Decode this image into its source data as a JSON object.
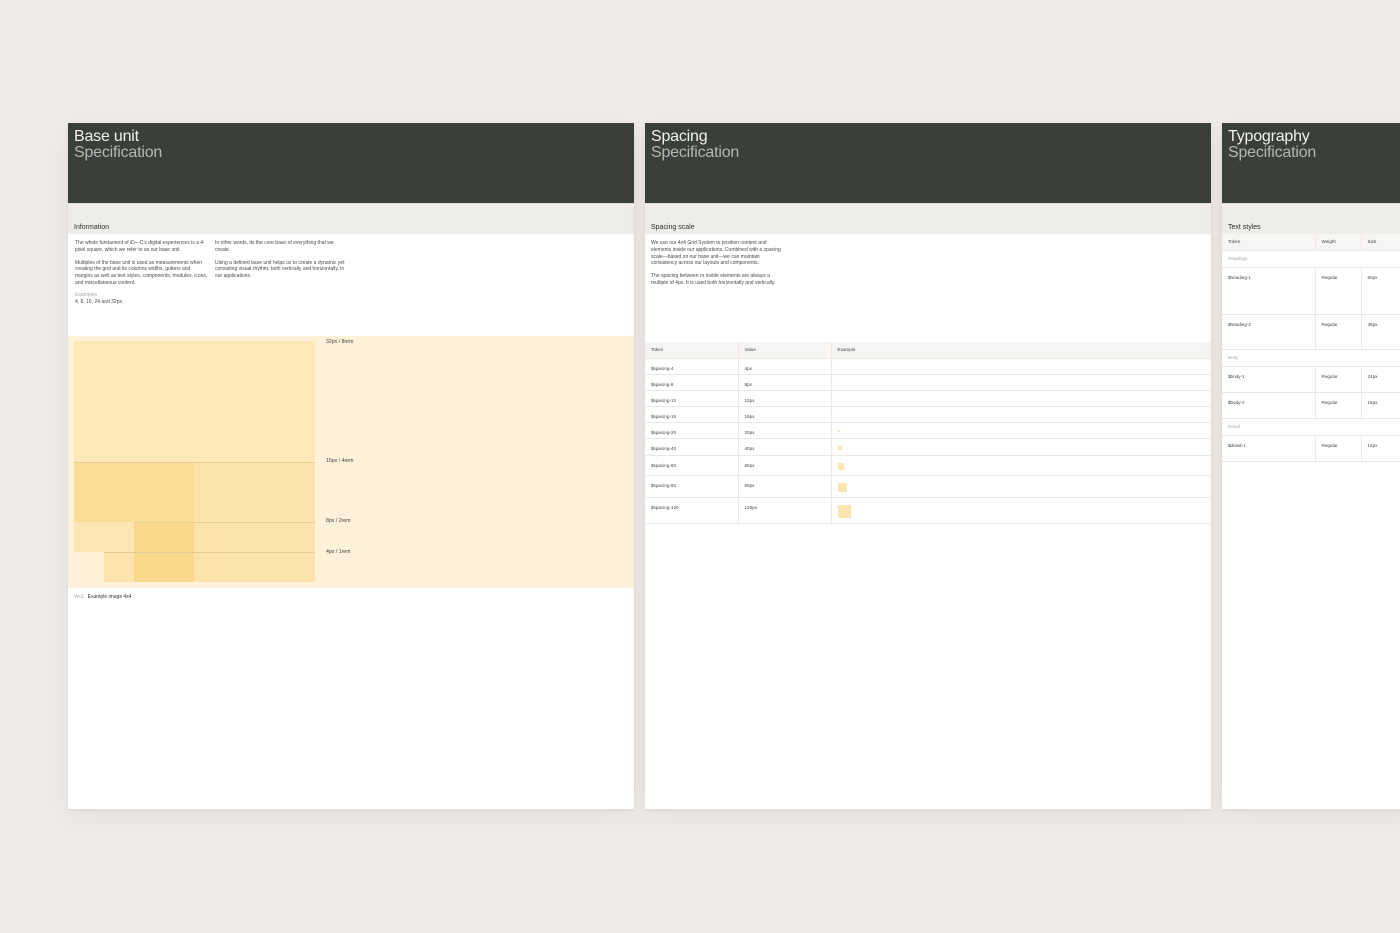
{
  "pages": {
    "base": {
      "title": "Base unit",
      "subtitle": "Specification",
      "section": "Information",
      "col1_p1": "The whole fundament of iD—C’s digital experiences is a 4-pixel square, which we refer to as our base unit.",
      "col1_p2": "Multiples of the base unit is used as measurements when creating the grid and its columns widths, gutters and margins as well as text styles, components, modules, icons, and miscellaneous content.",
      "examples_label": "Examples",
      "examples_value": "4, 8, 16, 24 and 32px.",
      "col2_p1": "In other words, its the core base of everything that we create.",
      "col2_p2": "Using a defined base unit helps us to create a dynamic yet consisting visual rhythm, both vertically and horizontally, in our applications.",
      "scale_labels": [
        "32px / 8rem",
        "16px / 4rem",
        "8px / 2rem",
        "4px / 1rem"
      ],
      "caption_fig": "Vis1",
      "caption_text": "Example image 4x4"
    },
    "spacing": {
      "title": "Spacing",
      "subtitle": "Specification",
      "section": "Spacing scale",
      "p1": "We use our 4x4 Grid System to position content and elements inside our applications. Combined with a spacing scale—based on our base unit—we can maintain consistency across our layouts and components.",
      "p2": "The spacing between or inside elements are always a multiple of 4px. It is used both horizontally and vertically.",
      "headers": [
        "Token",
        "Value",
        "Example"
      ],
      "rows": [
        {
          "token": "$spacing-4",
          "value": "4px",
          "size": 4
        },
        {
          "token": "$spacing-8",
          "value": "8px",
          "size": 8
        },
        {
          "token": "$spacing-12",
          "value": "12px",
          "size": 12
        },
        {
          "token": "$spacing-16",
          "value": "16px",
          "size": 16
        },
        {
          "token": "$spacing-20",
          "value": "20px",
          "size": 20
        },
        {
          "token": "$spacing-40",
          "value": "40px",
          "size": 40
        },
        {
          "token": "$spacing-60",
          "value": "60px",
          "size": 60
        },
        {
          "token": "$spacing-80",
          "value": "80px",
          "size": 80
        },
        {
          "token": "$spacing-120",
          "value": "120px",
          "size": 120
        }
      ]
    },
    "typography": {
      "title": "Typography",
      "subtitle": "Specification",
      "section": "Text styles",
      "headers": [
        "Token",
        "Weight",
        "Size"
      ],
      "groups": {
        "headings": "Headings",
        "body": "Body",
        "detail": "Detail"
      },
      "rows": {
        "h1": {
          "token": "$heading-1",
          "weight": "Regular",
          "size": "60px"
        },
        "h2": {
          "token": "$heading-2",
          "weight": "Regular",
          "size": "36px"
        },
        "b1": {
          "token": "$body-1",
          "weight": "Regular",
          "size": "24px"
        },
        "b2": {
          "token": "$body-2",
          "weight": "Regular",
          "size": "16px"
        },
        "d1": {
          "token": "$detail-1",
          "weight": "Regular",
          "size": "12px"
        }
      }
    }
  },
  "colors": {
    "header_bg": "#3a3f38",
    "canvas_bg": "#eeebe9",
    "accent_yellow": "#fde5af"
  }
}
